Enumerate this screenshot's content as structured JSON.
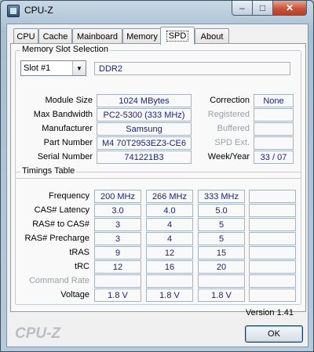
{
  "window": {
    "title": "CPU-Z"
  },
  "controls": {
    "minimize": "–",
    "maximize": "□",
    "close": "✕"
  },
  "tabs": [
    "CPU",
    "Cache",
    "Mainboard",
    "Memory",
    "SPD",
    "About"
  ],
  "active_tab": "SPD",
  "memory_slot": {
    "group_title": "Memory Slot Selection",
    "slot": "Slot #1",
    "type": "DDR2",
    "module_size_label": "Module Size",
    "module_size": "1024 MBytes",
    "max_bandwidth_label": "Max Bandwidth",
    "max_bandwidth": "PC2-5300 (333 MHz)",
    "manufacturer_label": "Manufacturer",
    "manufacturer": "Samsung",
    "part_number_label": "Part Number",
    "part_number": "M4 70T2953EZ3-CE6",
    "serial_number_label": "Serial Number",
    "serial_number": "741221B3",
    "correction_label": "Correction",
    "correction": "None",
    "registered_label": "Registered",
    "registered": "",
    "buffered_label": "Buffered",
    "buffered": "",
    "spd_ext_label": "SPD Ext.",
    "spd_ext": "",
    "week_year_label": "Week/Year",
    "week_year": "33 / 07"
  },
  "timings": {
    "group_title": "Timings Table",
    "rows": [
      {
        "label": "Frequency",
        "values": [
          "200 MHz",
          "266 MHz",
          "333 MHz",
          ""
        ]
      },
      {
        "label": "CAS# Latency",
        "values": [
          "3.0",
          "4.0",
          "5.0",
          ""
        ]
      },
      {
        "label": "RAS# to CAS#",
        "values": [
          "3",
          "4",
          "5",
          ""
        ]
      },
      {
        "label": "RAS# Precharge",
        "values": [
          "3",
          "4",
          "5",
          ""
        ]
      },
      {
        "label": "tRAS",
        "values": [
          "9",
          "12",
          "15",
          ""
        ]
      },
      {
        "label": "tRC",
        "values": [
          "12",
          "16",
          "20",
          ""
        ]
      },
      {
        "label": "Command Rate",
        "values": [
          "",
          "",
          "",
          ""
        ]
      },
      {
        "label": "Voltage",
        "values": [
          "1.8 V",
          "1.8 V",
          "1.8 V",
          ""
        ]
      }
    ]
  },
  "footer": {
    "version": "Version 1.41",
    "brand": "CPU-Z",
    "ok_label": "OK"
  }
}
